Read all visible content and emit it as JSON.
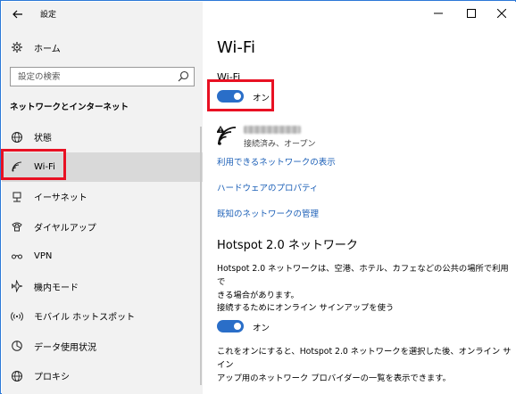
{
  "window": {
    "app_title": "設定",
    "minimize_icon": "minimize-icon",
    "maximize_icon": "maximize-icon",
    "close_icon": "close-icon"
  },
  "sidebar": {
    "back_icon": "arrow-left-icon",
    "home_label": "ホーム",
    "home_icon": "home-gear-icon",
    "search_placeholder": "設定の検索",
    "section_title": "ネットワークとインターネット",
    "items": [
      {
        "label": "状態",
        "icon": "globe-status-icon",
        "selected": false
      },
      {
        "label": "Wi-Fi",
        "icon": "wifi-icon",
        "selected": true
      },
      {
        "label": "イーサネット",
        "icon": "ethernet-icon",
        "selected": false
      },
      {
        "label": "ダイヤルアップ",
        "icon": "phone-icon",
        "selected": false
      },
      {
        "label": "VPN",
        "icon": "vpn-icon",
        "selected": false
      },
      {
        "label": "機内モード",
        "icon": "airplane-icon",
        "selected": false
      },
      {
        "label": "モバイル ホットスポット",
        "icon": "hotspot-icon",
        "selected": false
      },
      {
        "label": "データ使用状況",
        "icon": "data-usage-icon",
        "selected": false
      },
      {
        "label": "プロキシ",
        "icon": "globe-proxy-icon",
        "selected": false
      }
    ]
  },
  "main": {
    "title": "Wi-Fi",
    "wifi_toggle": {
      "label": "Wi-Fi",
      "state": "オン",
      "on": true
    },
    "network": {
      "status": "接続済み、オープン"
    },
    "links": [
      "利用できるネットワークの表示",
      "ハードウェアのプロパティ",
      "既知のネットワークの管理"
    ],
    "hotspot": {
      "heading": "Hotspot 2.0 ネットワーク",
      "description_line1": "Hotspot 2.0 ネットワークは、空港、ホテル、カフェなどの公共の場所で利用で",
      "description_line2": "きる場合があります。",
      "toggle_label": "接続するためにオンライン サインアップを使う",
      "toggle_state": "オン",
      "toggle_on": true,
      "note_line1": "これをオンにすると、Hotspot 2.0 ネットワークを選択した後、オンライン サイン",
      "note_line2": "アップ用のネットワーク プロバイダーの一覧を表示できます。"
    }
  },
  "highlight_color": "#e81123",
  "accent_color": "#2a6ec8"
}
